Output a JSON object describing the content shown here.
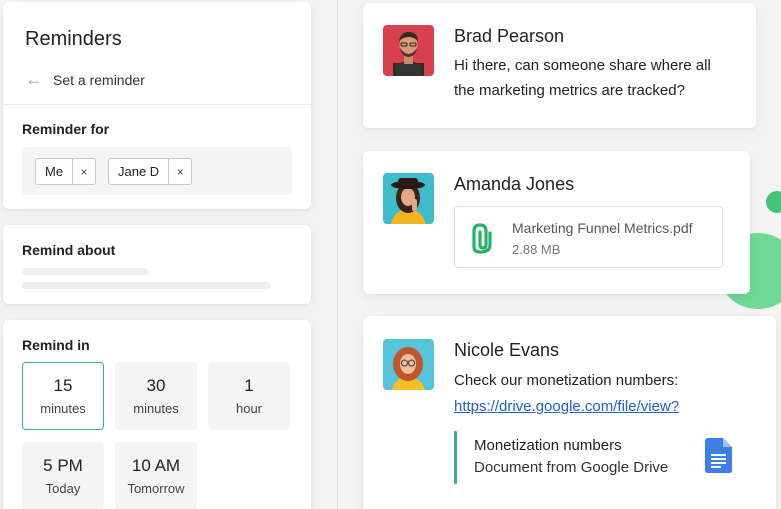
{
  "reminders": {
    "title": "Reminders",
    "back_label": "Set a reminder",
    "reminder_for_label": "Reminder for",
    "chips": [
      {
        "label": "Me",
        "remove": "×"
      },
      {
        "label": "Jane D",
        "remove": "×"
      }
    ],
    "remind_about_label": "Remind about",
    "remind_in_label": "Remind in",
    "options": [
      {
        "value": "15",
        "unit": "minutes",
        "selected": true
      },
      {
        "value": "30",
        "unit": "minutes",
        "selected": false
      },
      {
        "value": "1",
        "unit": "hour",
        "selected": false
      },
      {
        "value": "5 PM",
        "unit": "Today",
        "selected": false
      },
      {
        "value": "10 AM",
        "unit": "Tomorrow",
        "selected": false
      }
    ]
  },
  "messages": [
    {
      "author": "Brad Pearson",
      "text_lines": [
        "Hi there, can someone share where all",
        "the marketing metrics are tracked?"
      ],
      "avatar": "avatar-brad"
    },
    {
      "author": "Amanda Jones",
      "avatar": "avatar-amanda",
      "attachment": {
        "name": "Marketing Funnel Metrics.pdf",
        "size": "2.88 MB",
        "icon": "paperclip-icon"
      }
    },
    {
      "author": "Nicole Evans",
      "avatar": "avatar-nicole",
      "text": "Check our monetization numbers:",
      "link": "https://drive.google.com/file/view?",
      "preview": {
        "title": "Monetization numbers",
        "subtitle": "Document from Google Drive",
        "icon": "google-docs-icon"
      }
    }
  ],
  "colors": {
    "accent_green": "#35b577",
    "link_blue": "#1f5fd6",
    "decor_green": "#6fd895"
  }
}
